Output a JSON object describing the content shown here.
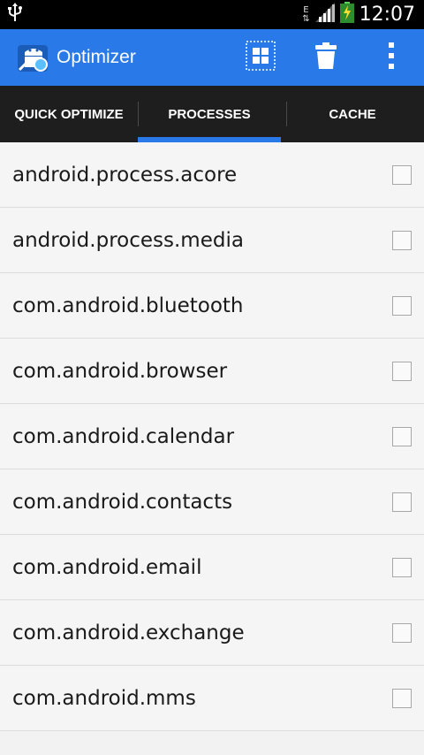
{
  "status_bar": {
    "time": "12:07",
    "network_type": "E",
    "icons": [
      "usb-icon",
      "data-arrows-icon",
      "signal-icon",
      "battery-charging-icon"
    ]
  },
  "action_bar": {
    "title": "Optimizer",
    "icons": [
      "app-logo-icon",
      "widget-grid-icon",
      "trash-icon",
      "overflow-menu-icon"
    ],
    "accent_color": "#2979e8"
  },
  "tabs": [
    {
      "label": "QUICK OPTIMIZE",
      "selected": false
    },
    {
      "label": "PROCESSES",
      "selected": true
    },
    {
      "label": "CACHE",
      "selected": false
    }
  ],
  "processes": [
    {
      "name": "android.process.acore",
      "checked": false
    },
    {
      "name": "android.process.media",
      "checked": false
    },
    {
      "name": "com.android.bluetooth",
      "checked": false
    },
    {
      "name": "com.android.browser",
      "checked": false
    },
    {
      "name": "com.android.calendar",
      "checked": false
    },
    {
      "name": "com.android.contacts",
      "checked": false
    },
    {
      "name": "com.android.email",
      "checked": false
    },
    {
      "name": "com.android.exchange",
      "checked": false
    },
    {
      "name": "com.android.mms",
      "checked": false
    }
  ]
}
